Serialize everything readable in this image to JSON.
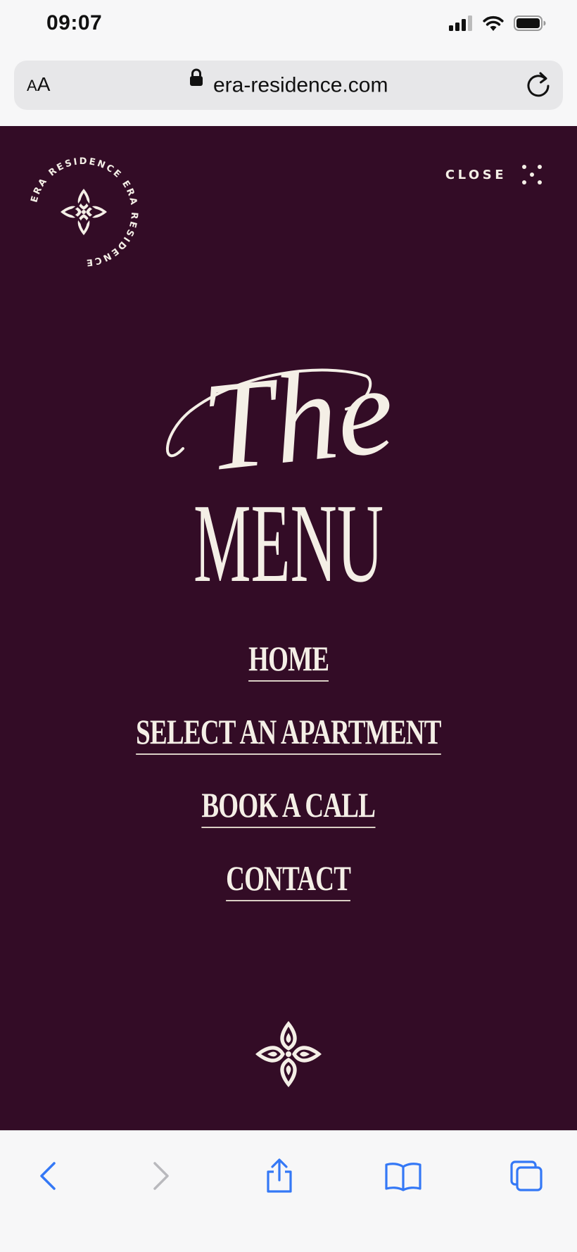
{
  "status_bar": {
    "time": "09:07",
    "icons": [
      "cellular-signal-icon",
      "wifi-icon",
      "battery-icon"
    ]
  },
  "browser": {
    "text_size_label_small": "A",
    "text_size_label_large": "A",
    "url": "era-residence.com",
    "icons": {
      "lock": "lock-icon",
      "reload": "reload-icon"
    }
  },
  "overlay": {
    "background_color": "#330c26",
    "text_color": "#f4efe6",
    "seal_text": "ERA RESIDENCE ERA RESIDENCE",
    "close_label": "CLOSE",
    "heading_script": "The",
    "heading_main": "MENU",
    "nav_items": [
      {
        "label": "HOME"
      },
      {
        "label": "SELECT AN APARTMENT"
      },
      {
        "label": "BOOK A CALL"
      },
      {
        "label": "CONTACT"
      }
    ]
  },
  "toolbar": {
    "accent_color": "#3478f6",
    "icons": [
      "back-icon",
      "forward-icon",
      "share-icon",
      "bookmarks-icon",
      "tabs-icon"
    ]
  }
}
